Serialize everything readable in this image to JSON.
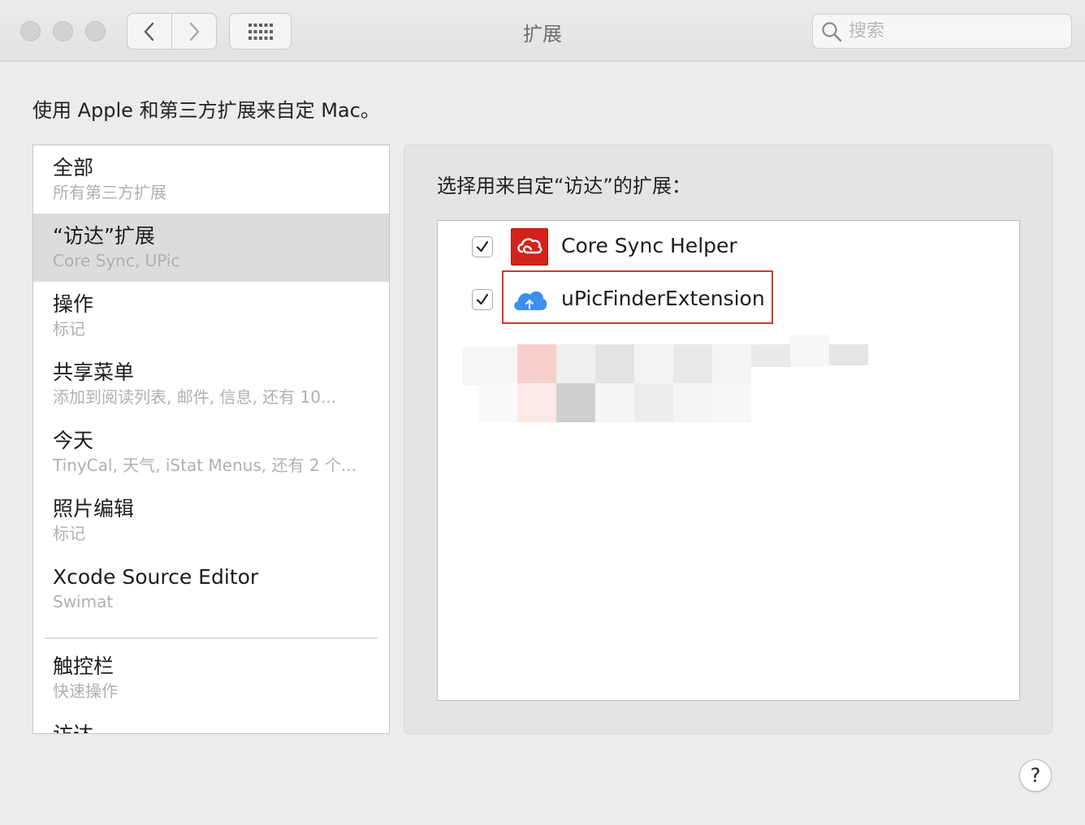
{
  "window": {
    "title": "扩展"
  },
  "search": {
    "placeholder": "搜索"
  },
  "intro": "使用 Apple 和第三方扩展来自定 Mac。",
  "sidebar": {
    "items": [
      {
        "title": "全部",
        "subtitle": "所有第三方扩展"
      },
      {
        "title": "“访达”扩展",
        "subtitle": "Core Sync, UPic"
      },
      {
        "title": "操作",
        "subtitle": "标记"
      },
      {
        "title": "共享菜单",
        "subtitle": "添加到阅读列表, 邮件, 信息, 还有 10..."
      },
      {
        "title": "今天",
        "subtitle": "TinyCal, 天气, iStat Menus, 还有 2 个..."
      },
      {
        "title": "照片编辑",
        "subtitle": "标记"
      },
      {
        "title": "Xcode Source Editor",
        "subtitle": "Swimat"
      },
      {
        "title": "触控栏",
        "subtitle": "快速操作"
      },
      {
        "title": "访达",
        "subtitle": ""
      }
    ],
    "selected_index": 1
  },
  "panel": {
    "title": "选择用来自定“访达”的扩展：",
    "extensions": [
      {
        "name": "Core Sync Helper",
        "checked": true,
        "icon": "adobe-creative-cloud-icon"
      },
      {
        "name": "uPicFinderExtension",
        "checked": true,
        "icon": "upic-cloud-icon"
      }
    ]
  },
  "help": {
    "label": "?"
  },
  "colors": {
    "highlight": "#d9342b",
    "selected_row": "#dcdcdc",
    "adobe_red": "#d4221b",
    "upic_blue": "#3d8ef0"
  }
}
